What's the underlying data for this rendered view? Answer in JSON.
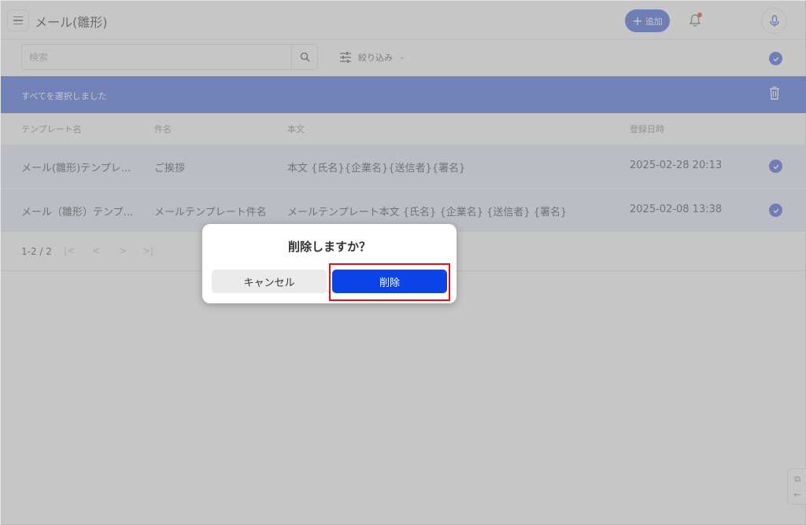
{
  "header": {
    "title": "メール(雛形)",
    "add_label": "追加",
    "colors": {
      "accent": "#3b5cd9",
      "bell_dot": "#e53935"
    }
  },
  "search": {
    "placeholder": "検索",
    "filter_label": "絞り込み"
  },
  "banner": {
    "text": "すべてを選択しました",
    "color": "#3e64e0"
  },
  "table": {
    "columns": [
      "テンプレート名",
      "件名",
      "本文",
      "登録日時"
    ],
    "rows": [
      {
        "name": "メール(雛形)テンプレ...",
        "subject": "ご挨拶",
        "body": "本文 {氏名}{企業名}{送信者}{署名}",
        "registered": "2025-02-28 20:13",
        "selected": true
      },
      {
        "name": "メール（雛形）テンプ...",
        "subject": "メールテンプレート件名",
        "body": "メールテンプレート本文 {氏名} {企業名} {送信者} {署名}",
        "registered": "2025-02-08 13:38",
        "selected": true
      }
    ]
  },
  "pagination": {
    "range": "1-2 / 2"
  },
  "dialog": {
    "title": "削除しますか？",
    "cancel_label": "キャンセル",
    "delete_label": "削除",
    "delete_color": "#0a44e6",
    "highlight_color": "#e01010"
  }
}
